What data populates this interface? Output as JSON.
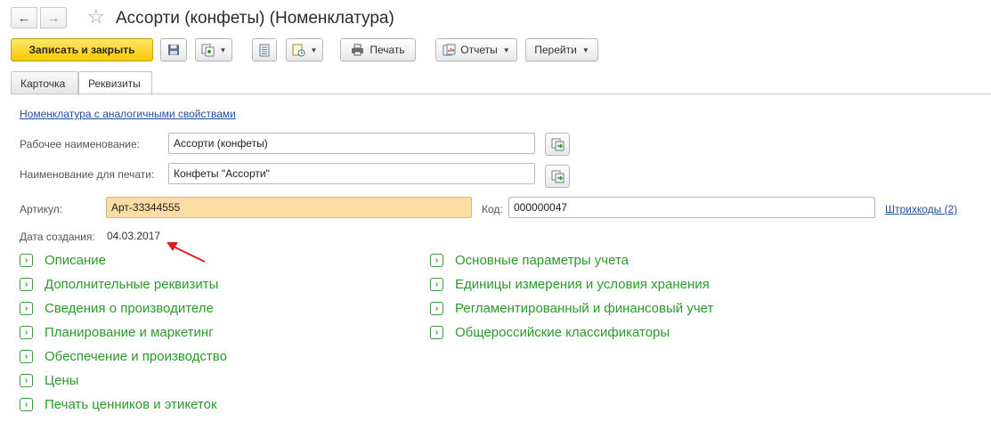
{
  "window": {
    "title": "Ассорти (конфеты) (Номенклатура)"
  },
  "toolbar": {
    "save_close_label": "Записать и закрыть",
    "print_label": "Печать",
    "reports_label": "Отчеты",
    "goto_label": "Перейти"
  },
  "tabs": [
    {
      "label": "Карточка",
      "active": false
    },
    {
      "label": "Реквизиты",
      "active": true
    }
  ],
  "form": {
    "similar_link": "Номенклатура с аналогичными свойствами",
    "work_name_label": "Рабочее наименование:",
    "work_name_value": "Ассорти (конфеты)",
    "print_name_label": "Наименование для печати:",
    "print_name_value": "Конфеты \"Ассорти\"",
    "article_label": "Артикул:",
    "article_value": "Арт-33344555",
    "code_label": "Код:",
    "code_value": "000000047",
    "barcodes_link": "Штрихкоды (2)",
    "created_label": "Дата создания:",
    "created_value": "04.03.2017"
  },
  "groups_left": [
    "Описание",
    "Дополнительные реквизиты",
    "Сведения о производителе",
    "Планирование и маркетинг",
    "Обеспечение и производство",
    "Цены",
    "Печать ценников и этикеток"
  ],
  "groups_right": [
    "Основные параметры учета",
    "Единицы измерения и условия хранения",
    "Регламентированный и финансовый учет",
    "Общероссийские классификаторы"
  ],
  "colors": {
    "primary_button": "#f5c900",
    "group_text": "#2b9a2b",
    "link": "#1f4f9e",
    "highlight_field": "#fbdda3",
    "annotation_arrow": "#e02020"
  }
}
